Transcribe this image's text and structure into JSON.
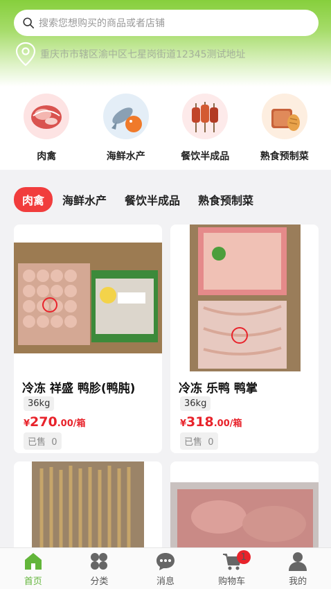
{
  "search": {
    "placeholder": "搜索您想购买的商品或者店铺"
  },
  "address": "重庆市市辖区渝中区七星岗街道12345测试地址",
  "categories": [
    {
      "label": "肉禽",
      "icon": "meat-icon"
    },
    {
      "label": "海鲜水产",
      "icon": "seafood-icon"
    },
    {
      "label": "餐饮半成品",
      "icon": "skewer-icon"
    },
    {
      "label": "熟食预制菜",
      "icon": "bread-icon"
    }
  ],
  "tabs": [
    {
      "label": "肉禽",
      "active": true
    },
    {
      "label": "海鲜水产"
    },
    {
      "label": "餐饮半成品"
    },
    {
      "label": "熟食预制菜"
    }
  ],
  "products": [
    {
      "name": "冷冻 祥盛 鸭胗(鸭肫)",
      "spec": "36kg",
      "currency": "¥",
      "price_int": "270",
      "price_dec": ".00",
      "unit": "/箱",
      "sold_label": "已售",
      "sold_count": "0"
    },
    {
      "name": "冷冻 乐鸭 鸭掌",
      "spec": "36kg",
      "currency": "¥",
      "price_int": "318",
      "price_dec": ".00",
      "unit": "/箱",
      "sold_label": "已售",
      "sold_count": "0"
    },
    {
      "name": "",
      "spec": ""
    },
    {
      "name": "",
      "spec": ""
    }
  ],
  "tabbar": [
    {
      "label": "首页",
      "icon": "home-icon",
      "active": true
    },
    {
      "label": "分类",
      "icon": "category-icon"
    },
    {
      "label": "消息",
      "icon": "message-icon"
    },
    {
      "label": "购物车",
      "icon": "cart-icon",
      "badge": "1"
    },
    {
      "label": "我的",
      "icon": "user-icon"
    }
  ],
  "colors": {
    "brand_green": "#62b53a",
    "accent_red": "#e8232b"
  }
}
